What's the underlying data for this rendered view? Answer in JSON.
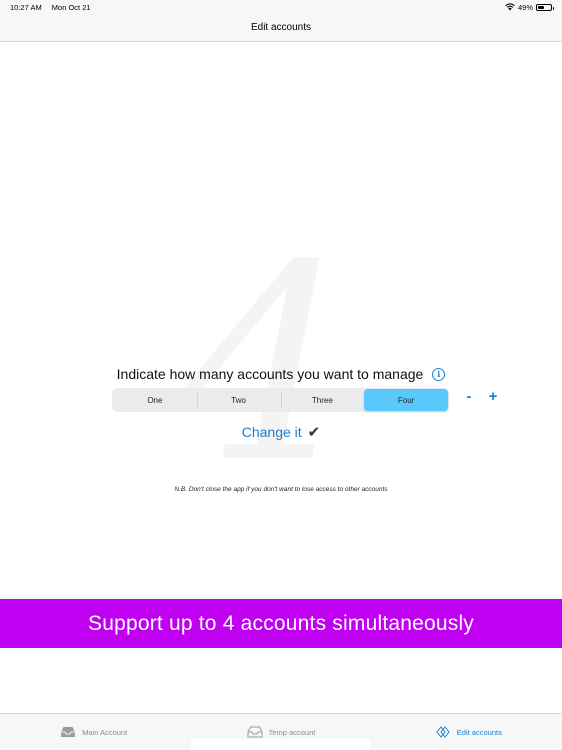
{
  "status_bar": {
    "time": "10:27 AM",
    "date": "Mon Oct 21",
    "battery_percent": "49%",
    "battery_level": 0.49
  },
  "nav": {
    "title": "Edit accounts"
  },
  "background_numeral": "4",
  "prompt": {
    "text": "Indicate how many accounts you want to manage",
    "icon": "info-icon"
  },
  "segments": [
    {
      "label": "One"
    },
    {
      "label": "Two"
    },
    {
      "label": "Three"
    },
    {
      "label": "Four"
    }
  ],
  "selected_segment": "Four",
  "stepper": {
    "minus": "-",
    "plus": "+"
  },
  "action": {
    "label": "Change it",
    "check": "✔"
  },
  "note": "N.B. Don't close the app if you don't want to lose access to other accounts",
  "banner": {
    "text": "Support up to 4 accounts simultaneously",
    "color": "#c000f0"
  },
  "tabs": [
    {
      "label": "Main Account",
      "icon": "inbox-tray-icon",
      "active": false
    },
    {
      "label": "Temp account",
      "icon": "inbox-tray-icon",
      "active": false
    },
    {
      "label": "Edit accounts",
      "icon": "layers-diamond-icon",
      "active": true
    }
  ],
  "colors": {
    "accent": "#1a7fd0",
    "segment_selected": "#5ac8fa"
  }
}
